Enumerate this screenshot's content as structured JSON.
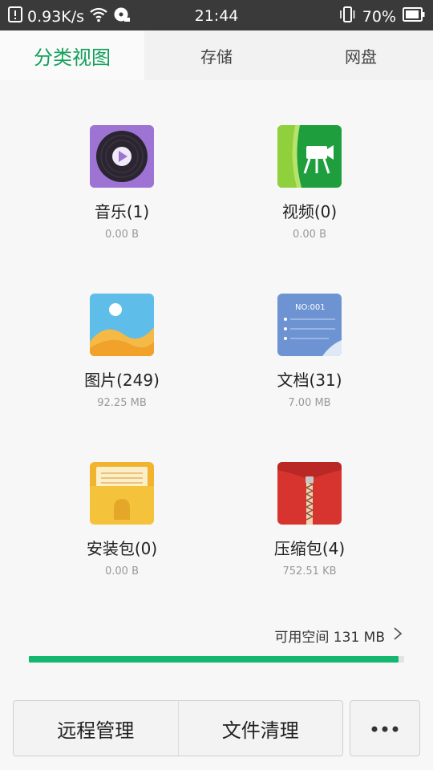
{
  "status_bar": {
    "net_speed": "0.93K/s",
    "time": "21:44",
    "battery": "70%",
    "icons": [
      "notification-icon",
      "wifi-icon",
      "disc-icon",
      "vibrate-icon",
      "battery-icon"
    ]
  },
  "tabs": [
    {
      "label": "分类视图",
      "active": true
    },
    {
      "label": "存储",
      "active": false
    },
    {
      "label": "网盘",
      "active": false
    }
  ],
  "categories": [
    {
      "label": "音乐(1)",
      "size": "0.00 B",
      "icon": "music-icon"
    },
    {
      "label": "视频(0)",
      "size": "0.00 B",
      "icon": "video-icon"
    },
    {
      "label": "图片(249)",
      "size": "92.25 MB",
      "icon": "image-icon"
    },
    {
      "label": "文档(31)",
      "size": "7.00 MB",
      "icon": "document-icon",
      "icon_text": "NO:001"
    },
    {
      "label": "安装包(0)",
      "size": "0.00 B",
      "icon": "apk-icon"
    },
    {
      "label": "压缩包(4)",
      "size": "752.51 KB",
      "icon": "archive-icon"
    }
  ],
  "storage": {
    "label": "可用空间 131 MB",
    "used_fraction": 0.985,
    "bar_color": "#13b76d"
  },
  "bottom": {
    "remote_manage": "远程管理",
    "file_clean": "文件清理",
    "more_icon": "more-icon"
  },
  "colors": {
    "accent": "#14a05a",
    "status_bar": "#3a3a3a"
  }
}
